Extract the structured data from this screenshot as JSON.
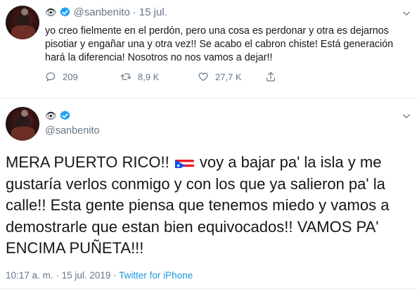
{
  "tweet1": {
    "name_emoji": "👁",
    "handle": "@sanbenito",
    "separator": "·",
    "date": "15 jul.",
    "text": "yo creo fielmente en el perdón, pero una cosa es perdonar y otra es dejarnos pisotiar y engañar una y otra vez!! Se acabo el cabron chiste! Está generación hará la diferencia! Nosotros no nos vamos a dejar!!",
    "reply_count": "209",
    "retweet_count": "8,9 K",
    "like_count": "27,7 K"
  },
  "tweet2": {
    "name_emoji": "👁",
    "handle": "@sanbenito",
    "text_before_flag": "MERA PUERTO RICO!! ",
    "text_after_flag": " voy a bajar pa' la isla y me gustaría verlos conmigo y con los que ya salieron pa' la calle!! Esta gente piensa que tenemos miedo y vamos a demostrarle que estan bien equivocados!! VAMOS PA' ENCIMA PUÑETA!!!",
    "time": "10:17 a. m.",
    "separator": "·",
    "date": "15 jul. 2019",
    "source": "Twitter for iPhone"
  },
  "icons": {
    "verified": "verified-badge-icon",
    "chevron": "chevron-down-icon",
    "reply": "reply-icon",
    "retweet": "retweet-icon",
    "like": "heart-icon",
    "share": "share-icon",
    "flag": "puerto-rico-flag-icon"
  },
  "colors": {
    "text": "#14171a",
    "secondary": "#657786",
    "accent": "#1da1f2",
    "source_link": "#1b95e0",
    "divider": "#e6ecf0"
  }
}
